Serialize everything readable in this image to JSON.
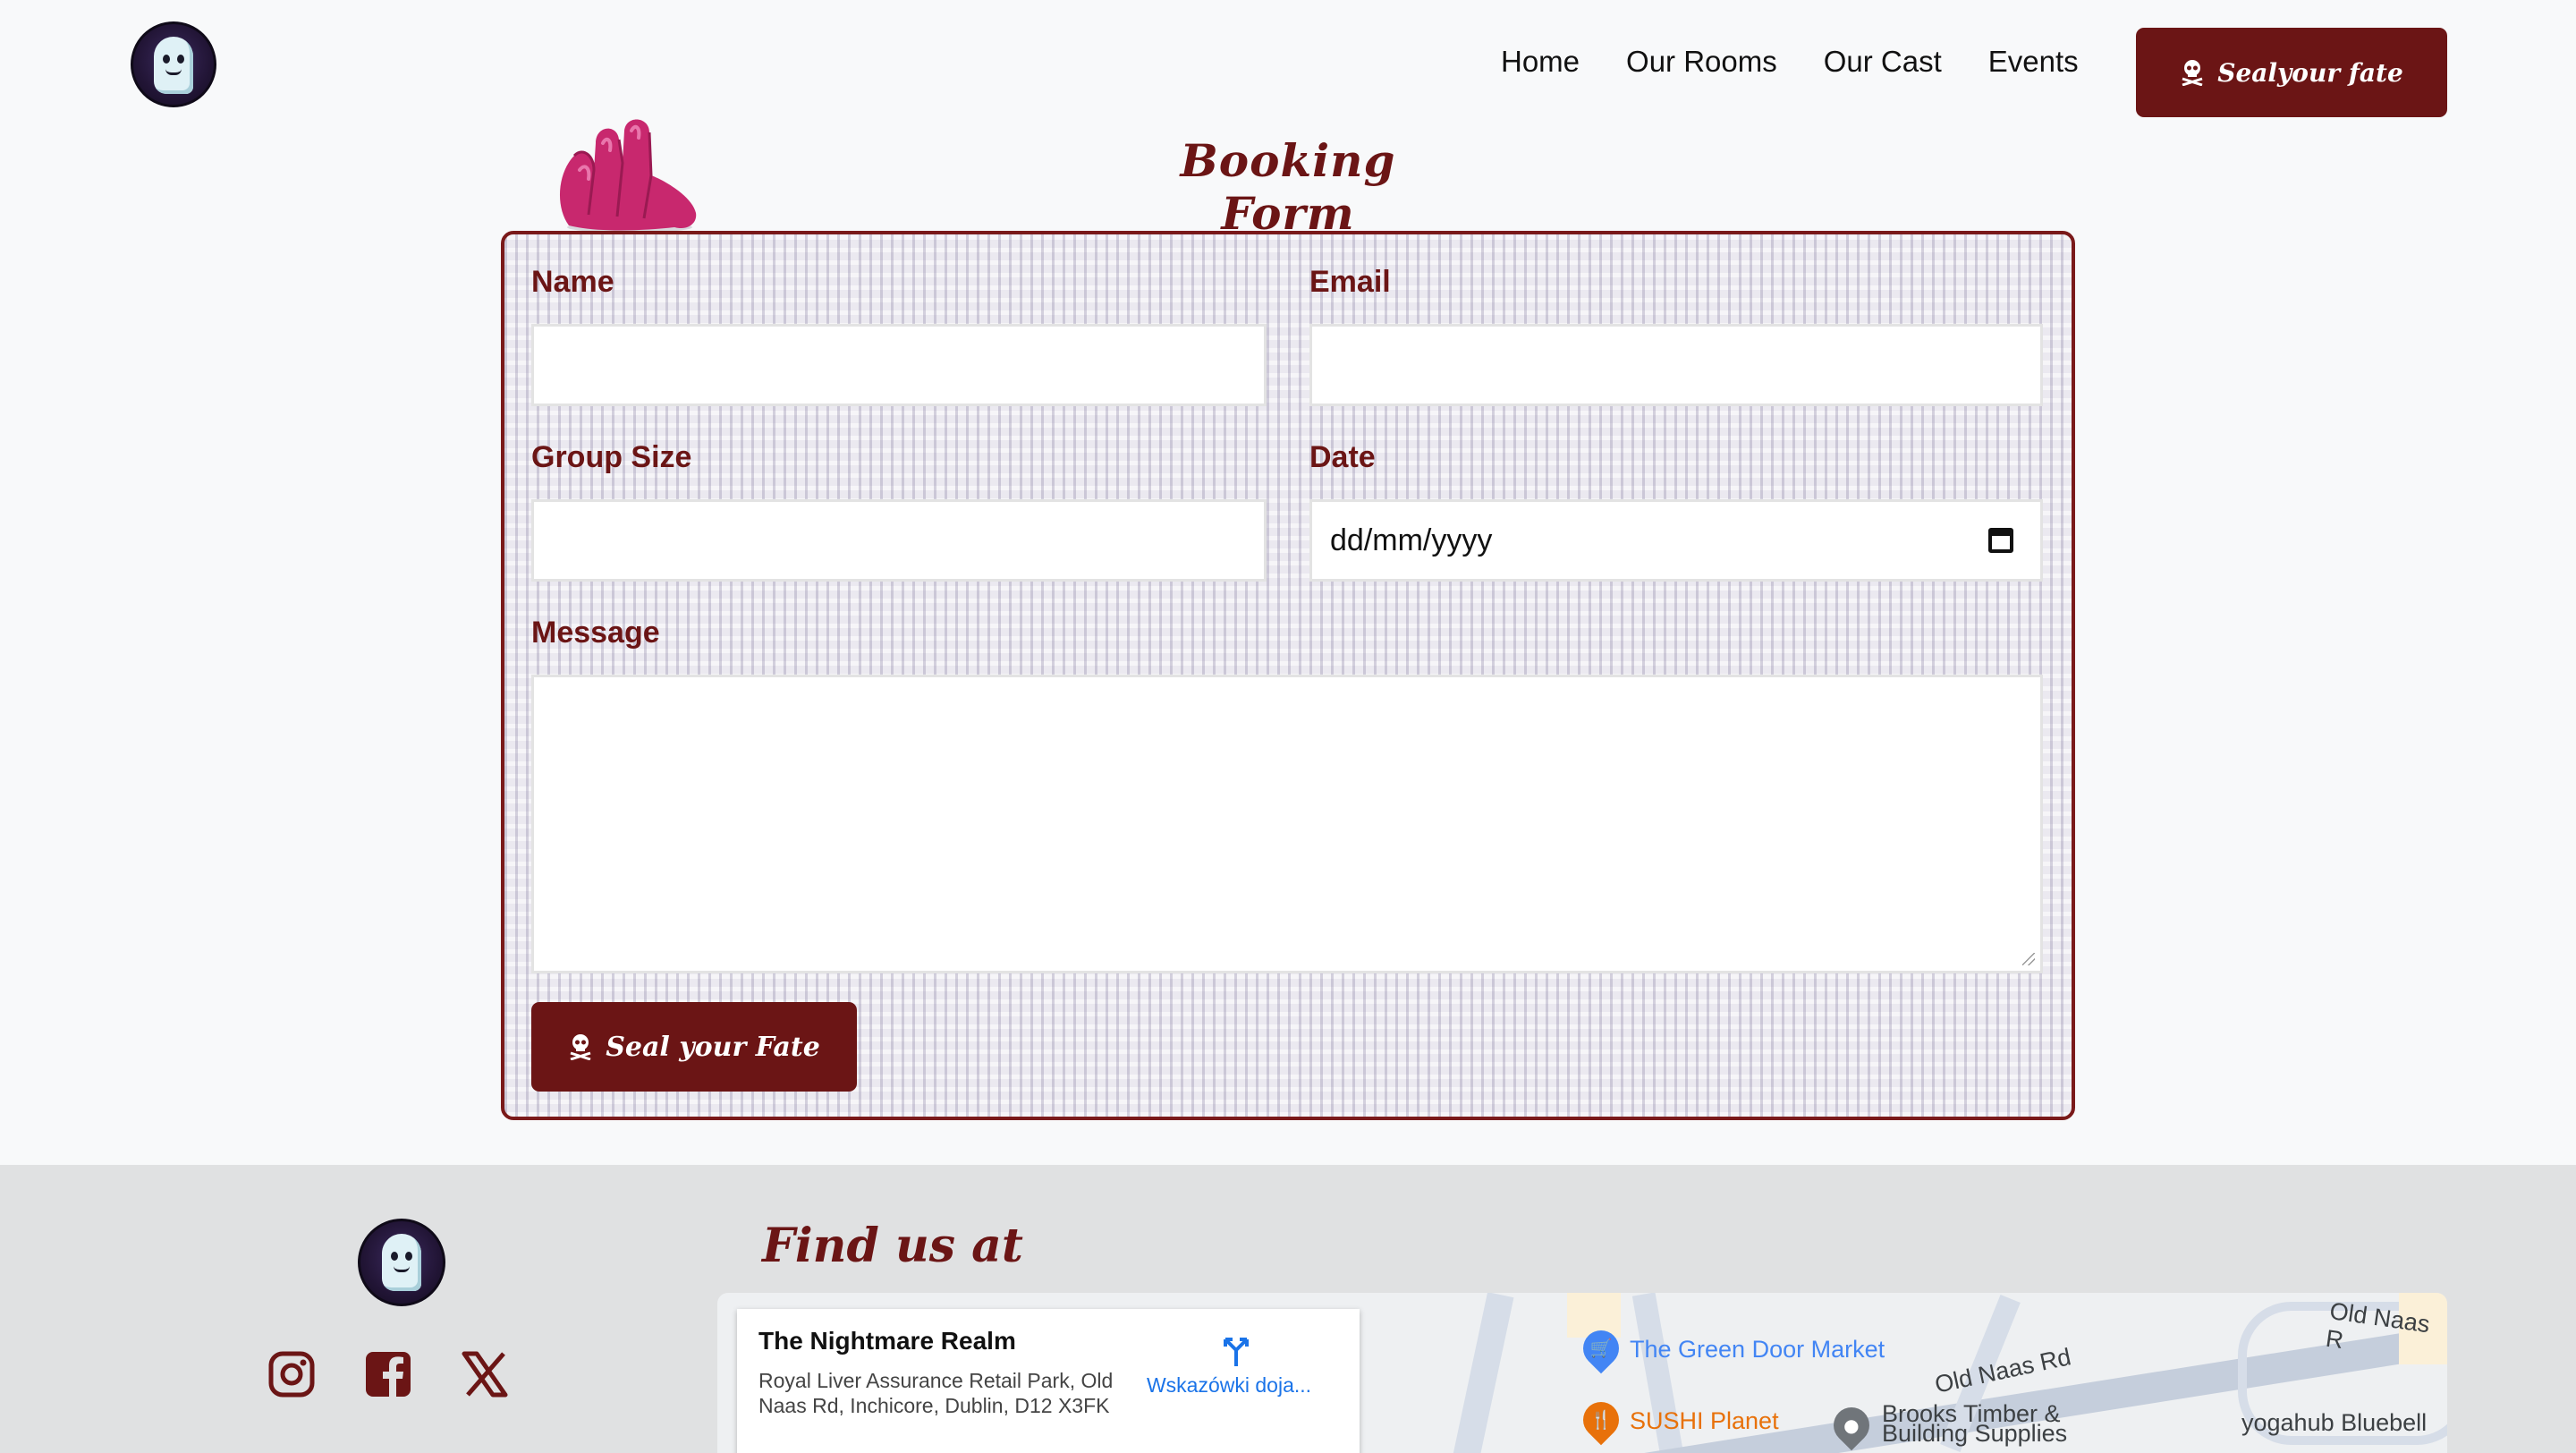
{
  "header": {
    "nav": [
      "Home",
      "Our Rooms",
      "Our Cast",
      "Events"
    ],
    "cta_label": "Sealyour fate"
  },
  "form": {
    "title": "Booking Form",
    "labels": {
      "name": "Name",
      "email": "Email",
      "group_size": "Group Size",
      "date": "Date",
      "message": "Message"
    },
    "values": {
      "name": "",
      "email": "",
      "group_size": "",
      "date": "dd/mm/yyyy",
      "message": ""
    },
    "submit_label": "Seal your Fate"
  },
  "footer": {
    "find_title": "Find us at",
    "social_icons": [
      "instagram-icon",
      "facebook-icon",
      "x-icon"
    ],
    "map": {
      "place_name": "The Nightmare Realm",
      "address": "Royal Liver Assurance Retail Park, Old Naas Rd, Inchicore, Dublin, D12 X3FK",
      "directions_label": "Wskazówki doja...",
      "labels": {
        "green_door": "The Green Door Market",
        "sushi": "SUSHI Planet",
        "brooks_1": "Brooks Timber &",
        "brooks_2": "Building Supplies",
        "old_naas_1": "Old Naas Rd",
        "old_naas_2": "Old Naas R",
        "yogahub": "yogahub Bluebell"
      },
      "colors": {
        "shop": "#4285f4",
        "food": "#e8710a",
        "generic": "#70757a",
        "road_label": "#3c4043"
      }
    }
  },
  "colors": {
    "brand": "#6b1515",
    "accent_pink": "#d63384",
    "background": "#f8f9fa",
    "footer_bg": "#e0e1e2"
  }
}
